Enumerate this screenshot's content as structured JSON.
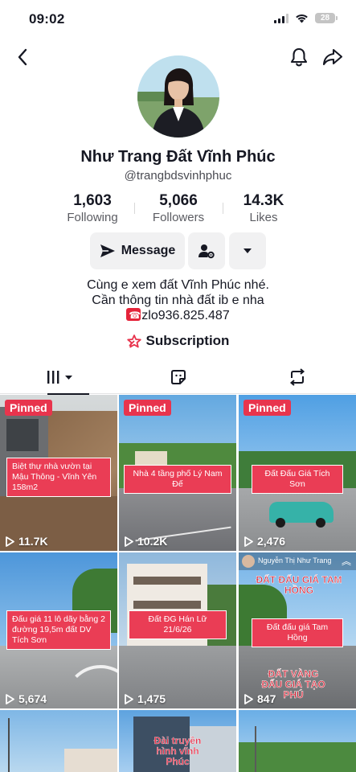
{
  "status_bar": {
    "time": "09:02",
    "battery": "28"
  },
  "nav": {
    "back_icon": "chevron-left-icon",
    "bell_icon": "bell-icon",
    "share_icon": "share-icon"
  },
  "profile": {
    "display_name": "Như Trang Đất Vĩnh Phúc",
    "username": "@trangbdsvinhphuc",
    "stats": {
      "following": {
        "value": "1,603",
        "label": "Following"
      },
      "followers": {
        "value": "5,066",
        "label": "Followers"
      },
      "likes": {
        "value": "14.3K",
        "label": "Likes"
      }
    },
    "actions": {
      "message_label": "Message"
    },
    "bio": {
      "line1": "Cùng e xem đất Vĩnh Phúc nhé.",
      "line2": "Cần thông tin nhà đất ib e nha",
      "line3": "zlo936.825.487"
    },
    "subscription_label": "Subscription"
  },
  "tabs": [
    {
      "name": "videos",
      "icon": "grid-icon",
      "active": true
    },
    {
      "name": "liked",
      "icon": "liked-icon",
      "active": false
    },
    {
      "name": "reposts",
      "icon": "repost-icon",
      "active": false
    }
  ],
  "videos": [
    {
      "pinned": "Pinned",
      "caption": "Biệt thự nhà vườn tại Mậu Thông - Vĩnh Yên 158m2",
      "views": "11.7K"
    },
    {
      "pinned": "Pinned",
      "caption": "Nhà 4 tầng phố Lý Nam Đế",
      "views": "10.2K"
    },
    {
      "pinned": "Pinned",
      "caption": "Đất Đấu Giá Tích Sơn",
      "views": "2,476"
    },
    {
      "caption": "Đấu giá 11 lô dãy bằng 2 đường 19,5m đất DV Tích Sơn",
      "views": "5,674"
    },
    {
      "caption": "Đất ĐG Hán Lữ 21/6/26",
      "views": "1,475",
      "tag": "Nguyễn Thị Như Trang"
    },
    {
      "caption": "Đất đấu giá Tam Hồng",
      "views": "847",
      "stamp_top": "ĐẤT ĐẤU GIÁ TAM HỒNG",
      "stamp_bottom": "ĐẤT VÀNG ĐẤU GIÁ TẠO PHÚ"
    },
    {
      "caption": ""
    },
    {
      "caption": "Đài truyền hình vĩnh Phúc"
    },
    {
      "caption": ""
    }
  ],
  "colors": {
    "accent": "#ea3d55",
    "text": "#161823",
    "button_bg": "#f1f1f2"
  }
}
